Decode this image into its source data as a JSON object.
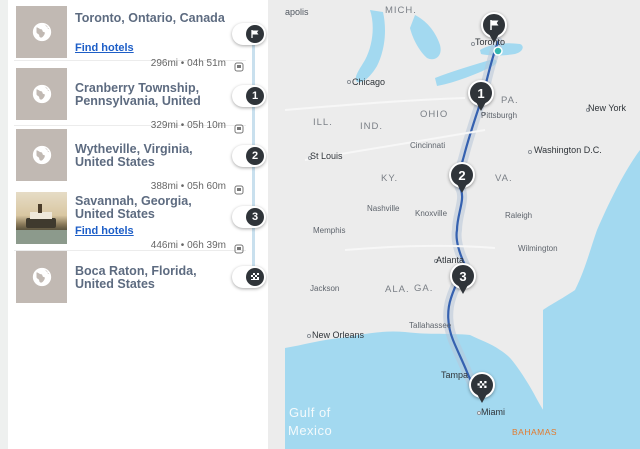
{
  "itinerary": {
    "stops": [
      {
        "name": "Toronto, Ontario, Canada",
        "link": "Find hotels",
        "marker": "flag-icon",
        "thumb": "globe-icon"
      },
      {
        "name": "Cranberry Township, Pennsylvania, United",
        "marker_label": "1",
        "thumb": "globe-icon"
      },
      {
        "name": "Wytheville, Virginia, United States",
        "marker_label": "2",
        "thumb": "globe-icon"
      },
      {
        "name": "Savannah, Georgia, United States",
        "link": "Find hotels",
        "marker_label": "3",
        "thumb": "photo"
      },
      {
        "name": "Boca Raton, Florida, United States",
        "marker": "checkered-flag-icon",
        "thumb": "globe-icon"
      }
    ],
    "legs": [
      {
        "distance_time": "296mi • 04h 51m",
        "icon": "toll-icon"
      },
      {
        "distance_time": "329mi • 05h 10m",
        "icon": "toll-icon"
      },
      {
        "distance_time": "388mi • 05h 60m",
        "icon": "toll-icon"
      },
      {
        "distance_time": "446mi • 06h 39m",
        "icon": "toll-icon"
      }
    ]
  },
  "map": {
    "labels": {
      "apolis": "apolis",
      "mich": "MICH.",
      "toronto": "Toronto",
      "chicago": "Chicago",
      "ohio": "OHIO",
      "pa": "PA.",
      "pittsburgh": "Pittsburgh",
      "new_york": "New York",
      "ill": "ILL.",
      "ind": "IND.",
      "cincinnati": "Cincinnati",
      "washington": "Washington D.C.",
      "st_louis": "St Louis",
      "ky": "KY.",
      "va": "VA.",
      "nashville": "Nashville",
      "knoxville": "Knoxville",
      "raleigh": "Raleigh",
      "memphis": "Memphis",
      "wilmington": "Wilmington",
      "atlanta": "Atlanta",
      "ala": "ALA.",
      "ga": "GA.",
      "jackson": "Jackson",
      "tallahassee": "Tallahassee",
      "new_orleans": "New Orleans",
      "tampa": "Tampa",
      "miami": "Miami",
      "gulf": "Gulf of",
      "mexico": "Mexico",
      "bahamas": "BAHAMAS"
    },
    "pins": [
      "1",
      "2",
      "3"
    ],
    "colors": {
      "water": "#a3d9f0",
      "land": "#ececec",
      "route": "#3561b0",
      "marker": "#2f3439",
      "link": "#1d5ec7",
      "stop_text": "#5d6b80"
    }
  }
}
